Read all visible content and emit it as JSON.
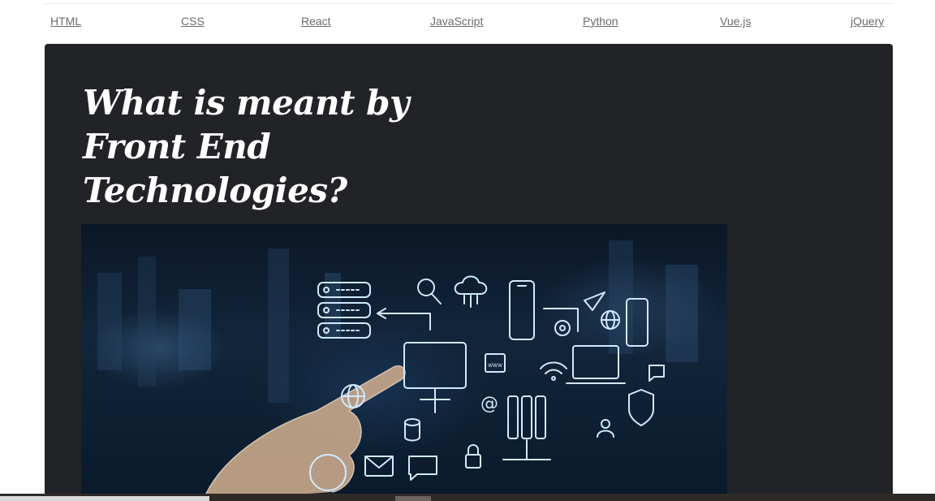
{
  "nav": {
    "links": [
      "HTML",
      "CSS",
      "React",
      "JavaScript",
      "Python",
      "Vue.js",
      "jQuery"
    ]
  },
  "hero": {
    "title": "What is meant by Front End Technologies?",
    "image_label": "WWW"
  },
  "colors": {
    "hero_background": "#212327",
    "link": "#6c6c6c",
    "icon_glow": "#cfeaff"
  }
}
